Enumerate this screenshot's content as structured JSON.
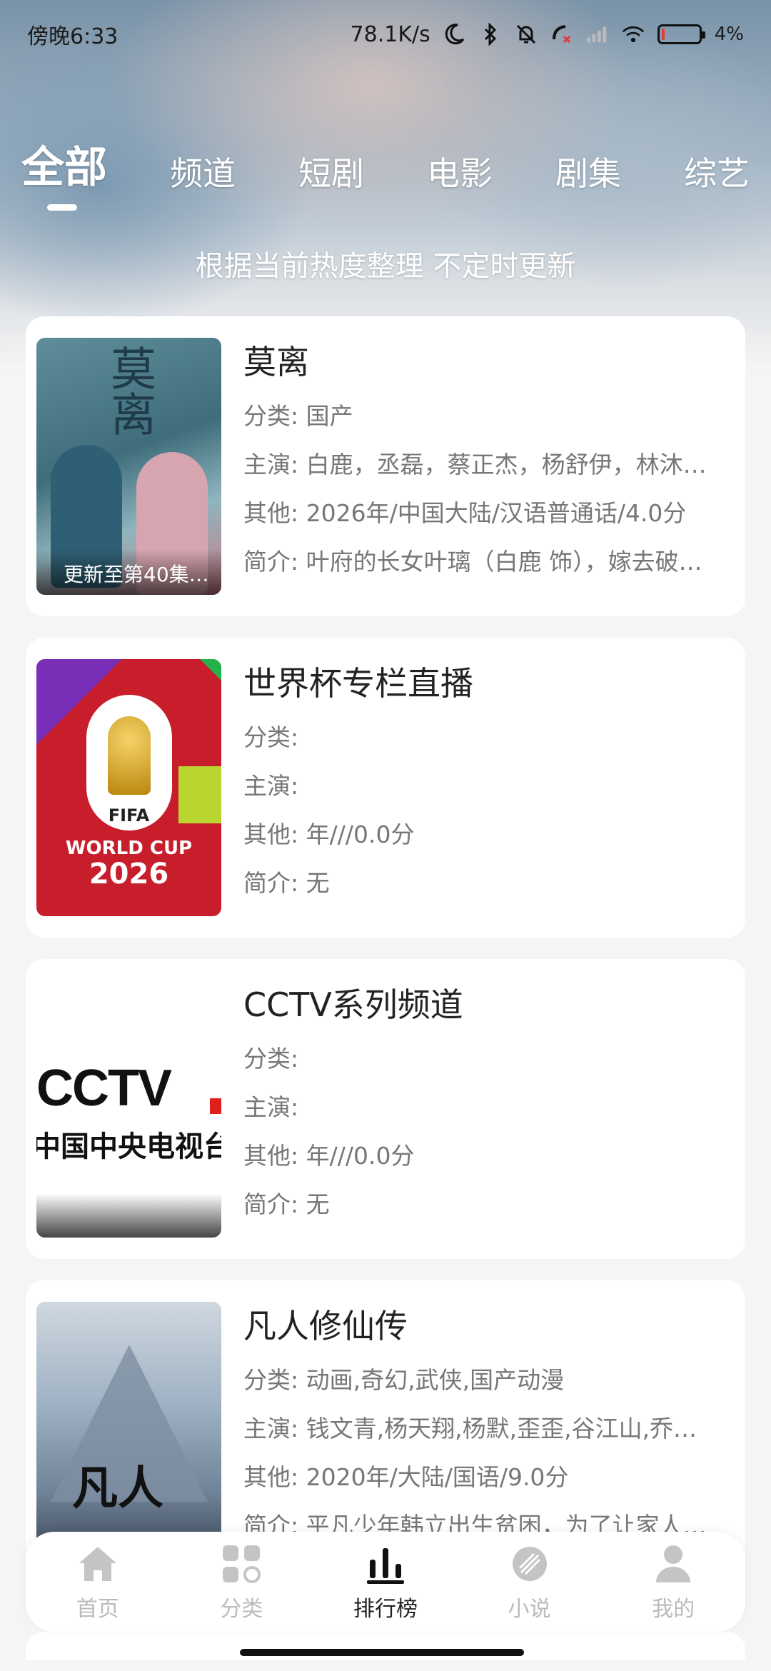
{
  "status_bar": {
    "time": "傍晚6:33",
    "network_speed": "78.1K/s",
    "battery": "4%"
  },
  "tabs": [
    {
      "label": "全部",
      "active": true
    },
    {
      "label": "频道",
      "active": false
    },
    {
      "label": "短剧",
      "active": false
    },
    {
      "label": "电影",
      "active": false
    },
    {
      "label": "剧集",
      "active": false
    },
    {
      "label": "综艺",
      "active": false
    }
  ],
  "subtitle": "根据当前热度整理 不定时更新",
  "items": [
    {
      "title": "莫离",
      "category": "分类: 国产",
      "cast": "主演: 白鹿，丞磊，蔡正杰，杨舒伊，林沐…",
      "other": "其他: 2026年/中国大陆/汉语普通话/4.0分",
      "intro": "简介: 叶府的长女叶璃（白鹿 饰），嫁去破…",
      "poster_caption": "更新至第40集…",
      "poster_calligraphy": "莫离"
    },
    {
      "title": "世界杯专栏直播",
      "category": "分类:",
      "cast": "主演:",
      "other": "其他: 年///0.0分",
      "intro": "简介: 无",
      "poster_text": [
        "FIFA",
        "WORLD CUP",
        "2026"
      ]
    },
    {
      "title": "CCTV系列频道",
      "category": "分类:",
      "cast": "主演:",
      "other": "其他: 年///0.0分",
      "intro": "简介: 无",
      "poster_text": [
        "CCTV",
        "中国中央电视台"
      ]
    },
    {
      "title": "凡人修仙传",
      "category": "分类: 动画,奇幻,武侠,国产动漫",
      "cast": "主演: 钱文青,杨天翔,杨默,歪歪,谷江山,乔…",
      "other": "其他: 2020年/大陆/国语/9.0分",
      "intro": "简介: 平凡少年韩立出生贫困，为了让家人…",
      "poster_calligraphy": "凡人"
    }
  ],
  "nav": [
    {
      "label": "首页",
      "icon": "home-icon",
      "active": false
    },
    {
      "label": "分类",
      "icon": "category-icon",
      "active": false
    },
    {
      "label": "排行榜",
      "icon": "ranking-icon",
      "active": true
    },
    {
      "label": "小说",
      "icon": "novel-icon",
      "active": false
    },
    {
      "label": "我的",
      "icon": "profile-icon",
      "active": false
    }
  ]
}
